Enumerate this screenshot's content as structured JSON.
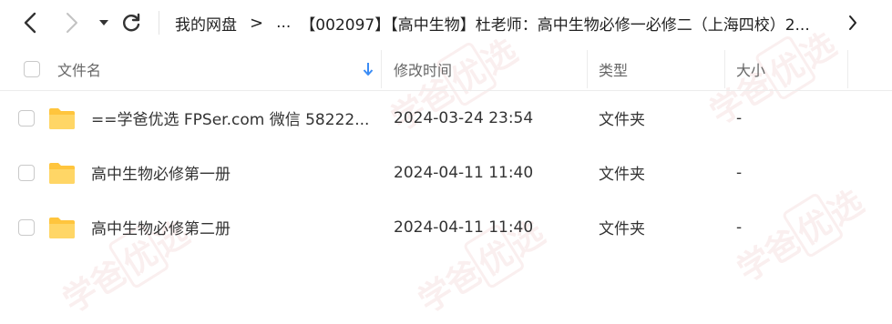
{
  "breadcrumb": {
    "root": "我的网盘",
    "sep": ">",
    "ellipsis": "...",
    "current": "【002097】【高中生物】杜老师：高中生物必修一必修二（上海四校）2..."
  },
  "columns": {
    "name": "文件名",
    "modified": "修改时间",
    "type": "类型",
    "size": "大小"
  },
  "files": [
    {
      "name": "==学爸优选 FPSer.com 微信 58222...",
      "modified": "2024-03-24 23:54",
      "type": "文件夹",
      "size": "-"
    },
    {
      "name": "高中生物必修第一册",
      "modified": "2024-04-11 11:40",
      "type": "文件夹",
      "size": "-"
    },
    {
      "name": "高中生物必修第二册",
      "modified": "2024-04-11 11:40",
      "type": "文件夹",
      "size": "-"
    }
  ],
  "watermark": {
    "text1": "学爸",
    "text2": "优",
    "text3": "选"
  },
  "colors": {
    "folder": "#ffc53d",
    "sort_arrow": "#3b8cf5",
    "watermark": "#c85050"
  }
}
